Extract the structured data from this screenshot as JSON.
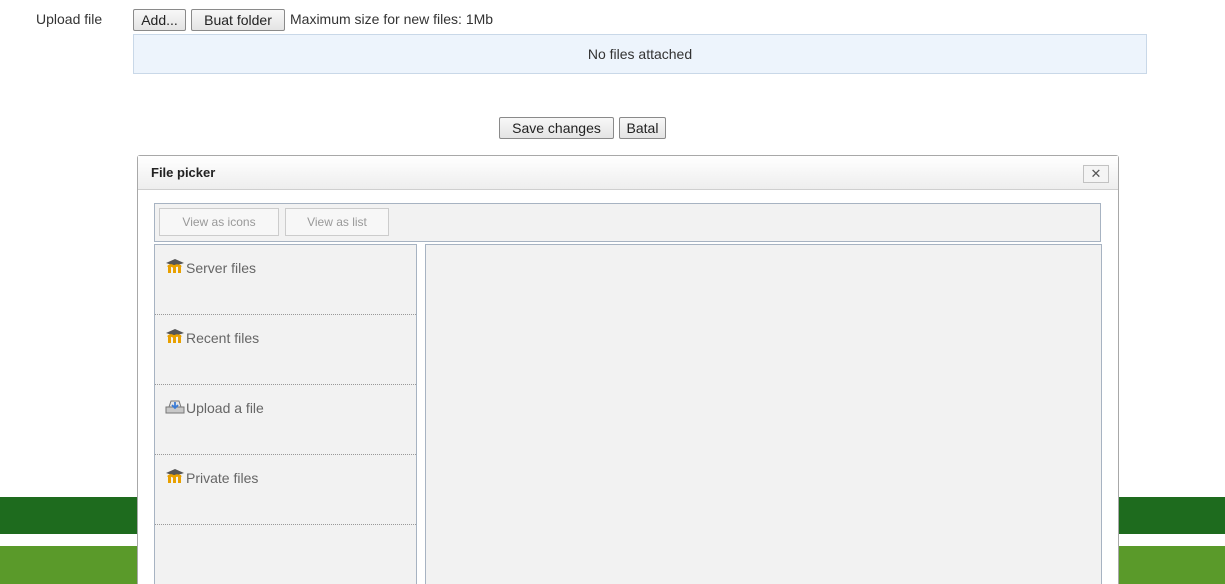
{
  "upload": {
    "label": "Upload file",
    "add_label": "Add...",
    "folder_label": "Buat folder",
    "max_size_text": "Maximum size for new files: 1Mb",
    "empty_text": "No files attached"
  },
  "form_actions": {
    "save_label": "Save changes",
    "cancel_label": "Batal"
  },
  "dialog": {
    "title": "File picker",
    "close_glyph": "✕",
    "view_icons_label": "View as icons",
    "view_list_label": "View as list",
    "repositories": [
      {
        "label": "Server files",
        "icon": "moodle-icon"
      },
      {
        "label": "Recent files",
        "icon": "moodle-icon"
      },
      {
        "label": "Upload a file",
        "icon": "upload-icon"
      },
      {
        "label": "Private files",
        "icon": "moodle-icon"
      }
    ]
  },
  "colors": {
    "files_box_bg": "#edf4fc",
    "band_dark": "#1e6b1e",
    "band_light_green": "#5a9a2a",
    "panel_bg": "#f2f2f2",
    "icon_orange": "#e8a000"
  }
}
